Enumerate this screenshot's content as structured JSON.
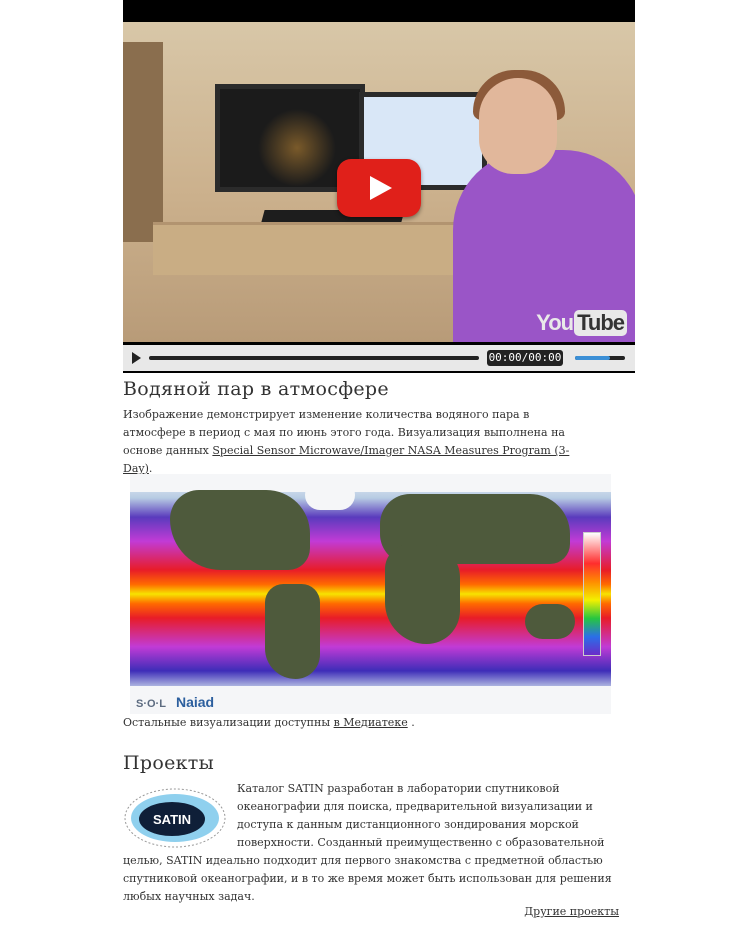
{
  "video": {
    "time": "00:00/00:00",
    "volume_level": 0.7,
    "progress": 0,
    "brand": {
      "you": "You",
      "tube": "Tube"
    }
  },
  "article": {
    "title": "Водяной пар в атмосфере",
    "description": "Изображение демонстрирует изменение количества водяного пара в атмосфере в период с мая по июнь этого года. Визуализация выполнена на основе данных ",
    "link_text": "Special Sensor Microwave/Imager NASA Measures Program (3-Day)",
    "description_end": ".",
    "map_credit_left": "S·O·L",
    "map_credit_right": "Naiad",
    "more_text": "Остальные визуализации доступны ",
    "more_link": "в Медиатеке",
    "more_end": " ."
  },
  "projects": {
    "title": "Проекты",
    "logo_text": "SATIN",
    "text": "Каталог SATIN разработан в лаборатории спутниковой океанографии для поиска, предварительной визуализации и доступа к данным дистанционного зондирования морской поверхности. Созданный преимущественно с образовательной целью, SATIN идеально подходит для первого знакомства с предметной областью спутниковой океанографии, и в то же время может быть использован для решения любых научных задач.",
    "other_link": "Другие проекты"
  },
  "colors": {
    "play_button": "#e0201a",
    "volume_accent": "#3b8fd6"
  }
}
